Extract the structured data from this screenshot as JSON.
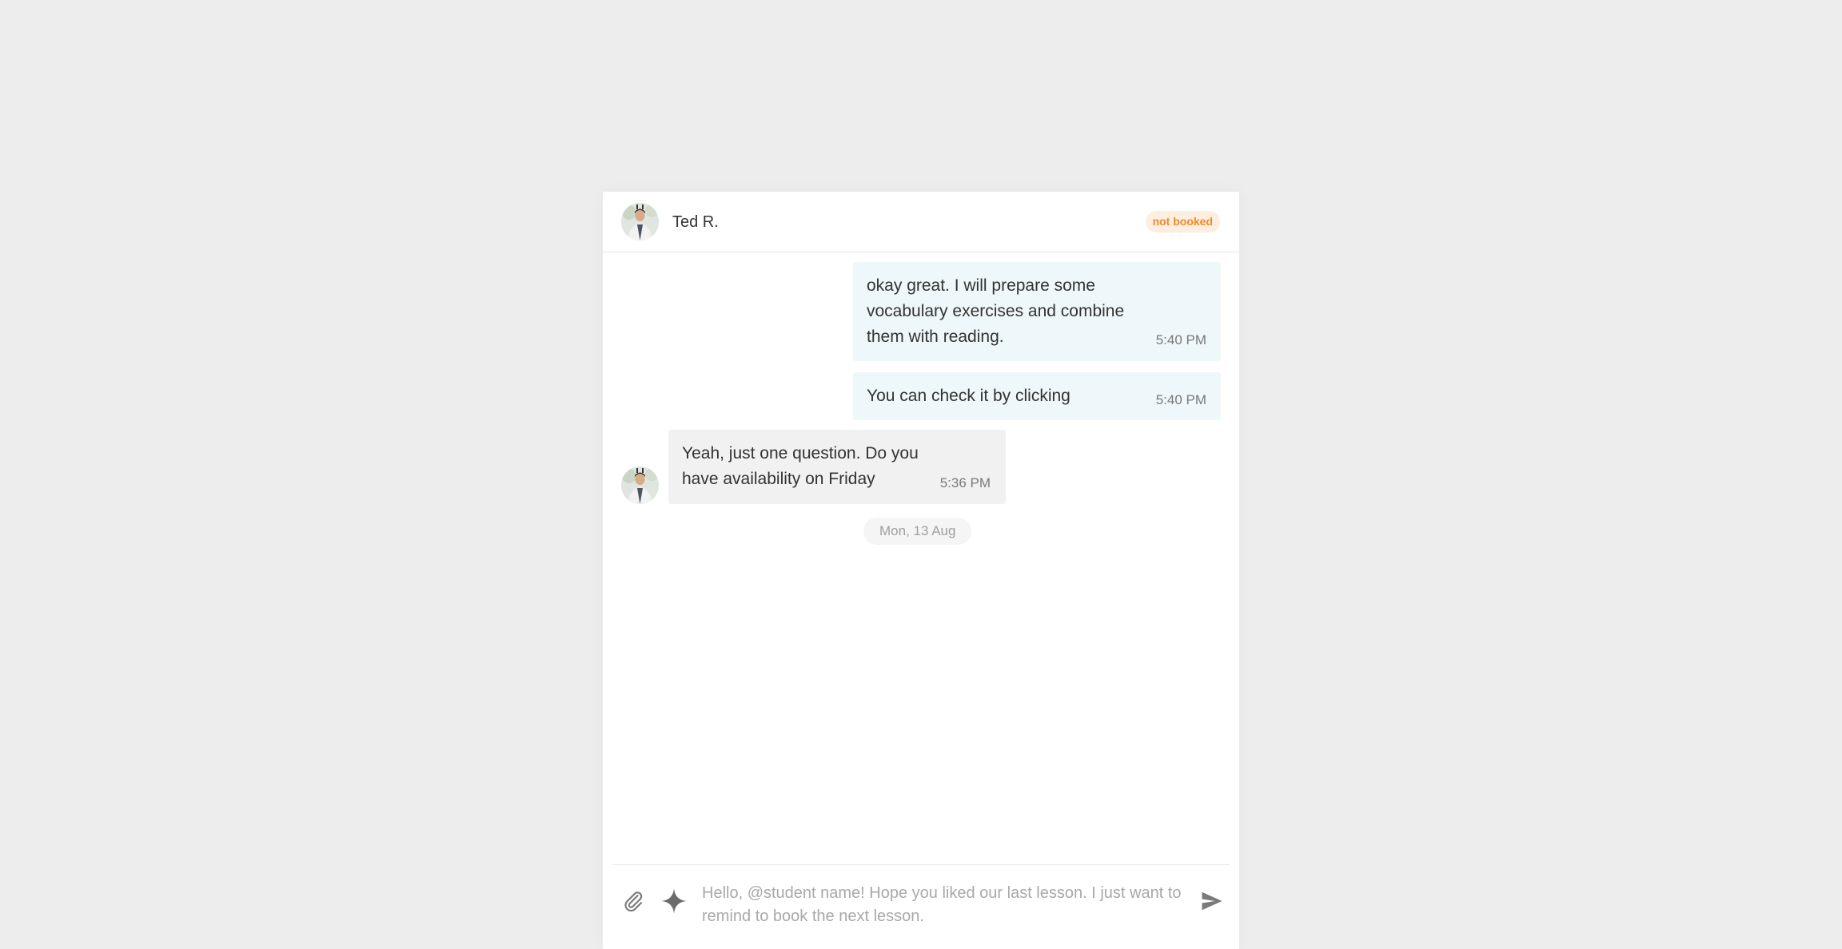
{
  "header": {
    "contact_name": "Ted R.",
    "status_badge": "not booked",
    "status_color": "#f08a2a",
    "avatar_icon": "user-avatar-photo"
  },
  "messages": [
    {
      "direction": "outgoing",
      "text": "okay great. I will prepare some vocabulary exercises and combine them with reading.",
      "time": "5:40 PM"
    },
    {
      "direction": "outgoing",
      "text": "You can check it by clicking",
      "time": "5:40 PM"
    },
    {
      "direction": "incoming",
      "text": "Yeah, just one question. Do you have availability on Friday",
      "time": "5:36 PM"
    }
  ],
  "date_separator": "Mon, 13 Aug",
  "composer": {
    "placeholder": "Hello, @student name! Hope you liked our last lesson. I just want to remind to book the next lesson.",
    "value": "",
    "attach_icon": "paperclip-icon",
    "ai_icon": "sparkle-icon",
    "send_icon": "send-icon"
  },
  "colors": {
    "page_bg": "#ededed",
    "outgoing_bubble": "#eef7f9",
    "incoming_bubble": "#f1f1f1",
    "badge_bg": "#fdeee0"
  }
}
